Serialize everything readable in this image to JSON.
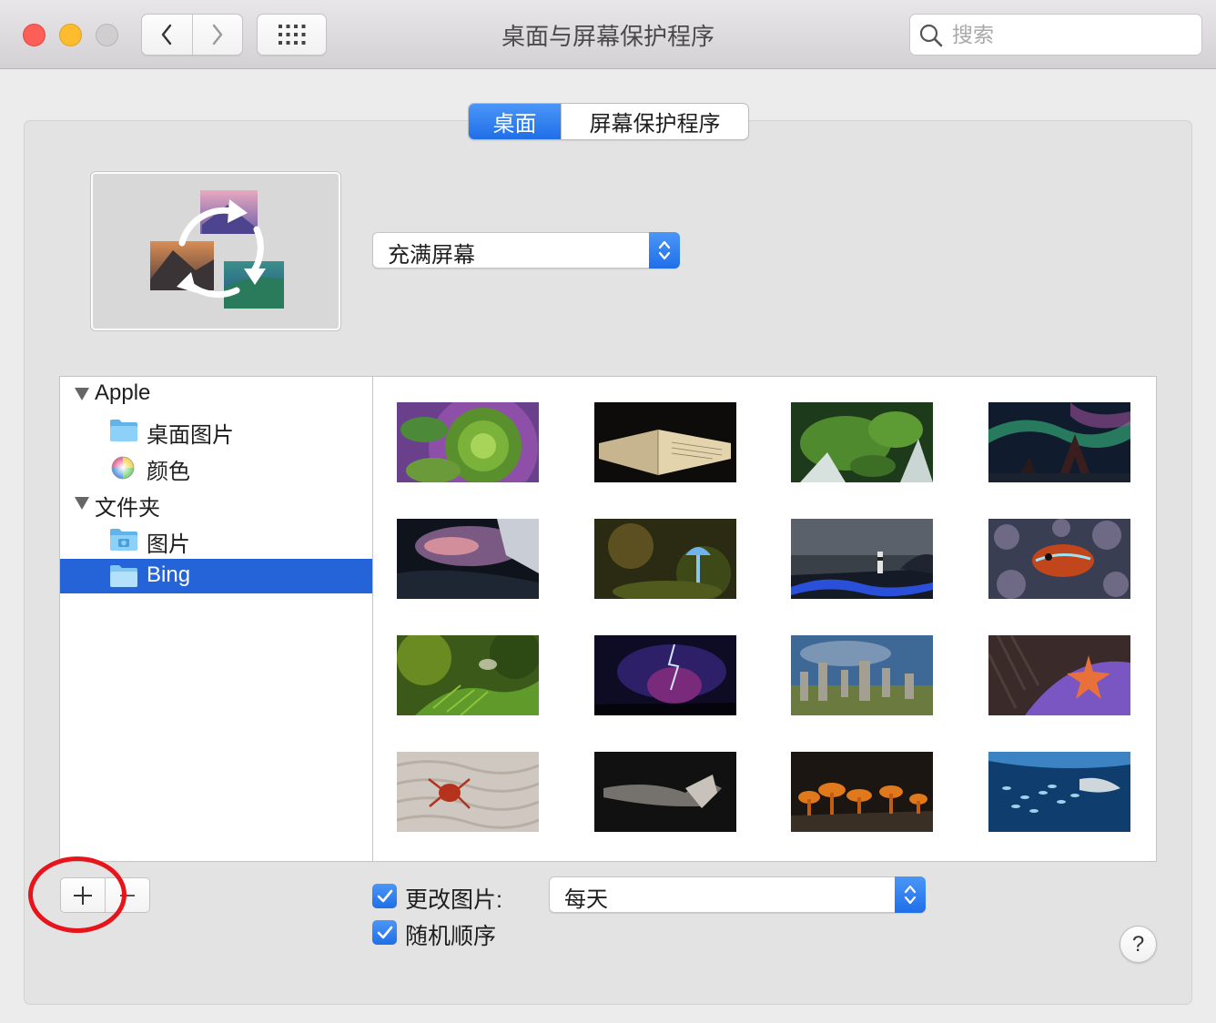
{
  "window": {
    "title": "桌面与屏幕保护程序"
  },
  "toolbar": {
    "back_icon": "chevron-left-icon",
    "forward_icon": "chevron-right-icon",
    "grid_icon": "show-all-grid-icon"
  },
  "search": {
    "placeholder": "搜索",
    "value": ""
  },
  "tabs": [
    {
      "label": "桌面",
      "active": true
    },
    {
      "label": "屏幕保护程序",
      "active": false
    }
  ],
  "fill_mode": {
    "selected": "充满屏幕"
  },
  "sidebar": {
    "groups": [
      {
        "label": "Apple",
        "expanded": true,
        "items": [
          {
            "label": "桌面图片",
            "icon": "folder-icon"
          },
          {
            "label": "颜色",
            "icon": "color-wheel-icon"
          }
        ]
      },
      {
        "label": "文件夹",
        "expanded": true,
        "items": [
          {
            "label": "图片",
            "icon": "pictures-folder-icon"
          },
          {
            "label": "Bing",
            "icon": "folder-icon",
            "selected": true
          }
        ]
      }
    ]
  },
  "gallery": {
    "thumbnails": [
      "succulent",
      "open-book",
      "mossy-stream",
      "aurora-arch",
      "sea-cave",
      "blue-mushroom",
      "lighthouse",
      "reef-fish",
      "glasswing-butterfly",
      "volcano-lightning",
      "standing-stones",
      "starfish",
      "red-crab",
      "gliding-bat",
      "orange-fungi",
      "fish-school"
    ]
  },
  "bottom": {
    "add_label": "+",
    "remove_label": "−",
    "change_picture": {
      "label": "更改图片:",
      "checked": true
    },
    "frequency": {
      "selected": "每天"
    },
    "random_order": {
      "label": "随机顺序",
      "checked": true
    },
    "help_label": "?"
  },
  "colors": {
    "accent": "#1f6fe8",
    "selection": "#2563d9",
    "annotation": "#e8141b"
  }
}
